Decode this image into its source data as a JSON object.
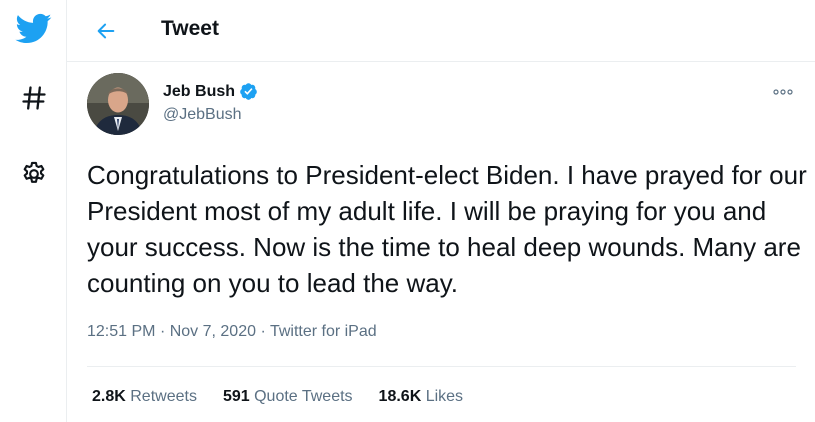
{
  "colors": {
    "accent": "#1da1f2",
    "text": "#0f1419",
    "muted": "#5b7083",
    "border": "#ebeef0"
  },
  "sidebar": {
    "logo_icon": "twitter-bird-icon",
    "explore_icon": "hashtag-icon",
    "settings_icon": "gear-icon"
  },
  "header": {
    "back_icon": "back-arrow-icon",
    "title": "Tweet"
  },
  "tweet": {
    "author": {
      "name": "Jeb Bush",
      "handle": "@JebBush",
      "verified": true
    },
    "text": "Congratulations to President-elect Biden. I have prayed for our President most of my adult life. I will be praying for you and your success. Now is the time to heal deep wounds. Many are counting on you to lead the way.",
    "time": "12:51 PM",
    "date": "Nov 7, 2020",
    "source": "Twitter for iPad",
    "separator": "·",
    "more_icon": "more-options-icon"
  },
  "stats": {
    "retweets": {
      "count": "2.8K",
      "label": "Retweets"
    },
    "quote_tweets": {
      "count": "591",
      "label": "Quote Tweets"
    },
    "likes": {
      "count": "18.6K",
      "label": "Likes"
    }
  }
}
